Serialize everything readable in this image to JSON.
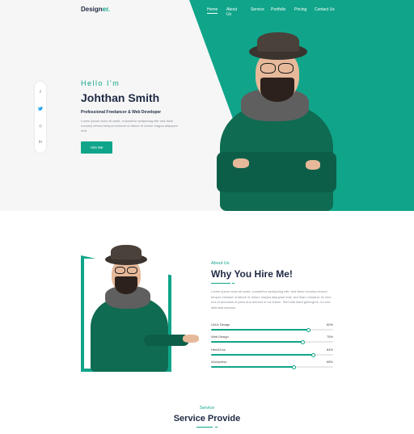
{
  "brand": {
    "name_main": "Design",
    "name_accent": "er."
  },
  "nav": {
    "items": [
      {
        "label": "Home"
      },
      {
        "label": "About Us"
      },
      {
        "label": "Service"
      },
      {
        "label": "Portfolio"
      },
      {
        "label": "Pricing"
      },
      {
        "label": "Contact Us"
      }
    ]
  },
  "social": {
    "facebook": "f",
    "twitter": "🐦",
    "instagram": "◎",
    "linkedin": "in"
  },
  "hero": {
    "greeting": "Hello I'm",
    "name": "Johthan Smith",
    "role": "Professional Freelancer & Web Developer",
    "intro": "Lorem ipsum dolor sit amet, consetetur sadipscing elitr sed diam nonumy eirmod tempor invidunt ut labore et dolore magna aliquyam erat.",
    "cta_label": "Hire Me"
  },
  "about": {
    "subtitle": "About Us",
    "title": "Why You Hire Me!",
    "text": "Lorem ipsum dolor sit amet, consetetur sadipscing elitr, sed diam nonumy eirmod tempor invidunt ut labore et dolore magna aliquyam erat, sed diam voluptua. At vero eos et accusam et justo duo dolores et ea rebum. Stet clita kasd gubergren, no sea takimata sanctus.",
    "skills": [
      {
        "label": "Ui/Ux Design",
        "percent_label": "80%",
        "value": 0.8
      },
      {
        "label": "Web Design",
        "percent_label": "75%",
        "value": 0.75
      },
      {
        "label": "Html&Css",
        "percent_label": "84%",
        "value": 0.84
      },
      {
        "label": "Wordpress",
        "percent_label": "68%",
        "value": 0.68
      }
    ]
  },
  "service": {
    "subtitle": "Service",
    "title": "Service Provide"
  },
  "colors": {
    "accent": "#10a58a",
    "dark": "#1f2a44"
  }
}
